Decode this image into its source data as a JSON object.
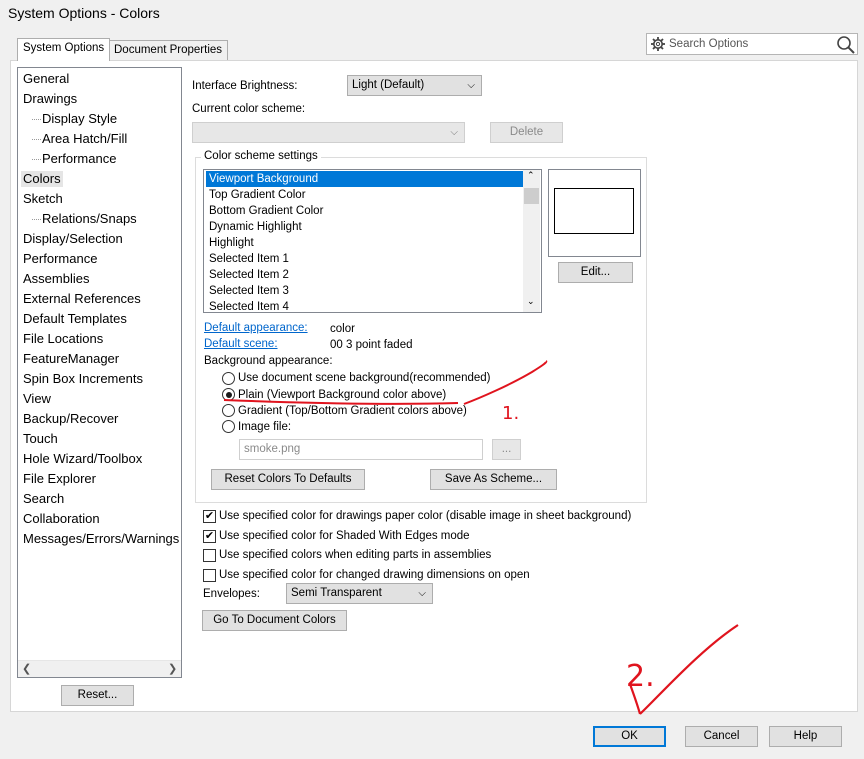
{
  "window": {
    "title": "System Options - Colors"
  },
  "tabs": [
    {
      "label": "System Options"
    },
    {
      "label": "Document Properties"
    }
  ],
  "search": {
    "placeholder": "Search Options"
  },
  "tree": {
    "items": [
      {
        "label": "General",
        "indent": 0
      },
      {
        "label": "Drawings",
        "indent": 0
      },
      {
        "label": "Display Style",
        "indent": 1
      },
      {
        "label": "Area Hatch/Fill",
        "indent": 1
      },
      {
        "label": "Performance",
        "indent": 1
      },
      {
        "label": "Colors",
        "indent": 0,
        "selected": true
      },
      {
        "label": "Sketch",
        "indent": 0
      },
      {
        "label": "Relations/Snaps",
        "indent": 1
      },
      {
        "label": "Display/Selection",
        "indent": 0
      },
      {
        "label": "Performance",
        "indent": 0
      },
      {
        "label": "Assemblies",
        "indent": 0
      },
      {
        "label": "External References",
        "indent": 0
      },
      {
        "label": "Default Templates",
        "indent": 0
      },
      {
        "label": "File Locations",
        "indent": 0
      },
      {
        "label": "FeatureManager",
        "indent": 0
      },
      {
        "label": "Spin Box Increments",
        "indent": 0
      },
      {
        "label": "View",
        "indent": 0
      },
      {
        "label": "Backup/Recover",
        "indent": 0
      },
      {
        "label": "Touch",
        "indent": 0
      },
      {
        "label": "Hole Wizard/Toolbox",
        "indent": 0
      },
      {
        "label": "File Explorer",
        "indent": 0
      },
      {
        "label": "Search",
        "indent": 0
      },
      {
        "label": "Collaboration",
        "indent": 0
      },
      {
        "label": "Messages/Errors/Warnings",
        "indent": 0
      }
    ],
    "reset_label": "Reset..."
  },
  "main": {
    "brightness_label": "Interface Brightness:",
    "brightness_value": "Light (Default)",
    "scheme_label": "Current color scheme:",
    "scheme_value": "",
    "delete_label": "Delete",
    "group_title": "Color scheme settings",
    "color_items": [
      "Viewport Background",
      "Top Gradient Color",
      "Bottom Gradient Color",
      "Dynamic Highlight",
      "Highlight",
      "Selected Item 1",
      "Selected Item 2",
      "Selected Item 3",
      "Selected Item 4"
    ],
    "edit_label": "Edit...",
    "default_appearance_label": "Default appearance:",
    "default_appearance_value": "color",
    "default_scene_label": "Default scene:",
    "default_scene_value": "00 3 point faded",
    "background_label": "Background appearance:",
    "bg_options": [
      "Use document scene background(recommended)",
      "Plain (Viewport Background color above)",
      "Gradient (Top/Bottom Gradient colors above)",
      "Image file:"
    ],
    "bg_selected": 1,
    "image_file_value": "smoke.png",
    "browse_label": "...",
    "reset_colors_label": "Reset Colors To Defaults",
    "save_scheme_label": "Save As Scheme...",
    "checks": [
      {
        "label": "Use specified color for drawings paper color (disable image in sheet background)",
        "checked": true
      },
      {
        "label": "Use specified color for Shaded With Edges mode",
        "checked": true
      },
      {
        "label": "Use specified colors when editing parts in assemblies",
        "checked": false
      },
      {
        "label": "Use specified color for changed drawing dimensions on open",
        "checked": false
      }
    ],
    "envelopes_label": "Envelopes:",
    "envelopes_value": "Semi Transparent",
    "go_doc_colors_label": "Go To Document Colors"
  },
  "footer": {
    "ok": "OK",
    "cancel": "Cancel",
    "help": "Help"
  },
  "annotations": {
    "mark1": "1.",
    "mark2": "2."
  },
  "colors": {
    "selection": "#0078d7",
    "link": "#0066cc",
    "annotation": "#e0141e"
  }
}
